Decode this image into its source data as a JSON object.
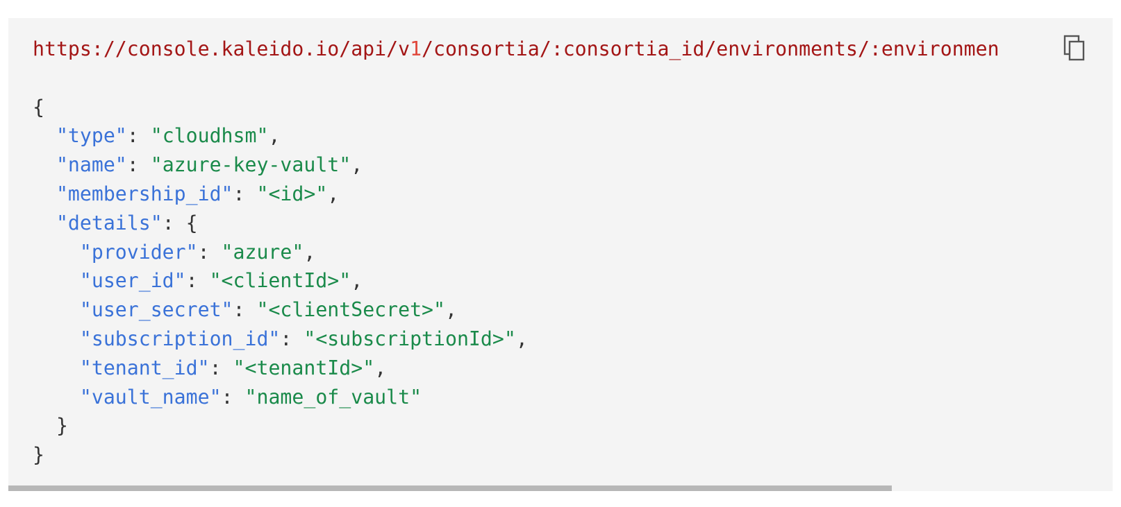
{
  "code_block": {
    "request_url_prefix": "https://console.kaleido.io/api/v",
    "request_url_version": "1",
    "request_url_suffix": "/consortia/:consortia_id/environments/:environmen",
    "lines": [
      {
        "indent": "",
        "open": "{"
      },
      {
        "indent": "  ",
        "key": "\"type\"",
        "sep": ": ",
        "value": "\"cloudhsm\"",
        "trail": ","
      },
      {
        "indent": "  ",
        "key": "\"name\"",
        "sep": ": ",
        "value": "\"azure-key-vault\"",
        "trail": ","
      },
      {
        "indent": "  ",
        "key": "\"membership_id\"",
        "sep": ": ",
        "value": "\"<id>\"",
        "trail": ","
      },
      {
        "indent": "  ",
        "key": "\"details\"",
        "sep": ": ",
        "trail": "{"
      },
      {
        "indent": "    ",
        "key": "\"provider\"",
        "sep": ": ",
        "value": "\"azure\"",
        "trail": ","
      },
      {
        "indent": "    ",
        "key": "\"user_id\"",
        "sep": ": ",
        "value": "\"<clientId>\"",
        "trail": ","
      },
      {
        "indent": "    ",
        "key": "\"user_secret\"",
        "sep": ": ",
        "value": "\"<clientSecret>\"",
        "trail": ","
      },
      {
        "indent": "    ",
        "key": "\"subscription_id\"",
        "sep": ": ",
        "value": "\"<subscriptionId>\"",
        "trail": ","
      },
      {
        "indent": "    ",
        "key": "\"tenant_id\"",
        "sep": ": ",
        "value": "\"<tenantId>\"",
        "trail": ","
      },
      {
        "indent": "    ",
        "key": "\"vault_name\"",
        "sep": ": ",
        "value": "\"name_of_vault\"",
        "trail": ""
      },
      {
        "indent": "  ",
        "close": "}"
      },
      {
        "indent": "",
        "close": "}"
      }
    ]
  },
  "icons": {
    "copy": "copy-icon"
  },
  "colors": {
    "background": "#f4f4f4",
    "url": "#a31515",
    "key": "#3a72d8",
    "string": "#1a8a4a",
    "punctuation": "#333333",
    "scrollbar_thumb": "#b7b7b7"
  },
  "scrollbar": {
    "horizontal_visible_fraction": 0.8
  }
}
